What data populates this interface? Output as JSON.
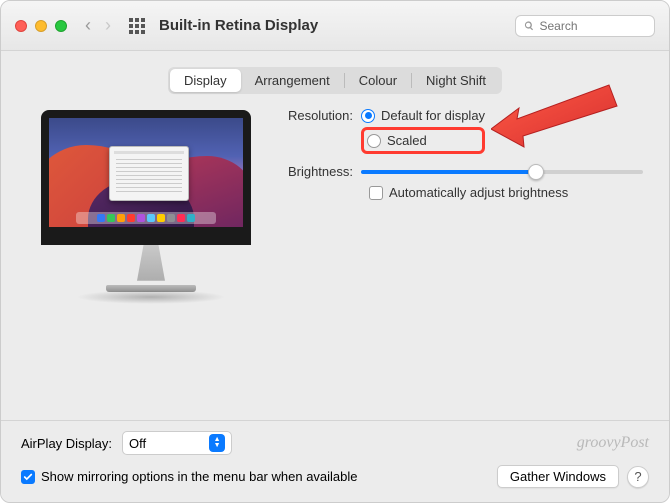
{
  "window": {
    "title": "Built-in Retina Display"
  },
  "search": {
    "placeholder": "Search"
  },
  "tabs": {
    "display": "Display",
    "arrangement": "Arrangement",
    "colour": "Colour",
    "night_shift": "Night Shift",
    "selected": "display"
  },
  "settings": {
    "resolution_label": "Resolution:",
    "resolution_default": "Default for display",
    "resolution_scaled": "Scaled",
    "resolution_selected": "default",
    "brightness_label": "Brightness:",
    "brightness_value_pct": 62,
    "auto_brightness_label": "Automatically adjust brightness",
    "auto_brightness_checked": false
  },
  "airplay": {
    "label": "AirPlay Display:",
    "value": "Off"
  },
  "mirroring": {
    "label": "Show mirroring options in the menu bar when available",
    "checked": true
  },
  "buttons": {
    "gather_windows": "Gather Windows",
    "help": "?"
  },
  "watermark": "groovyPost"
}
